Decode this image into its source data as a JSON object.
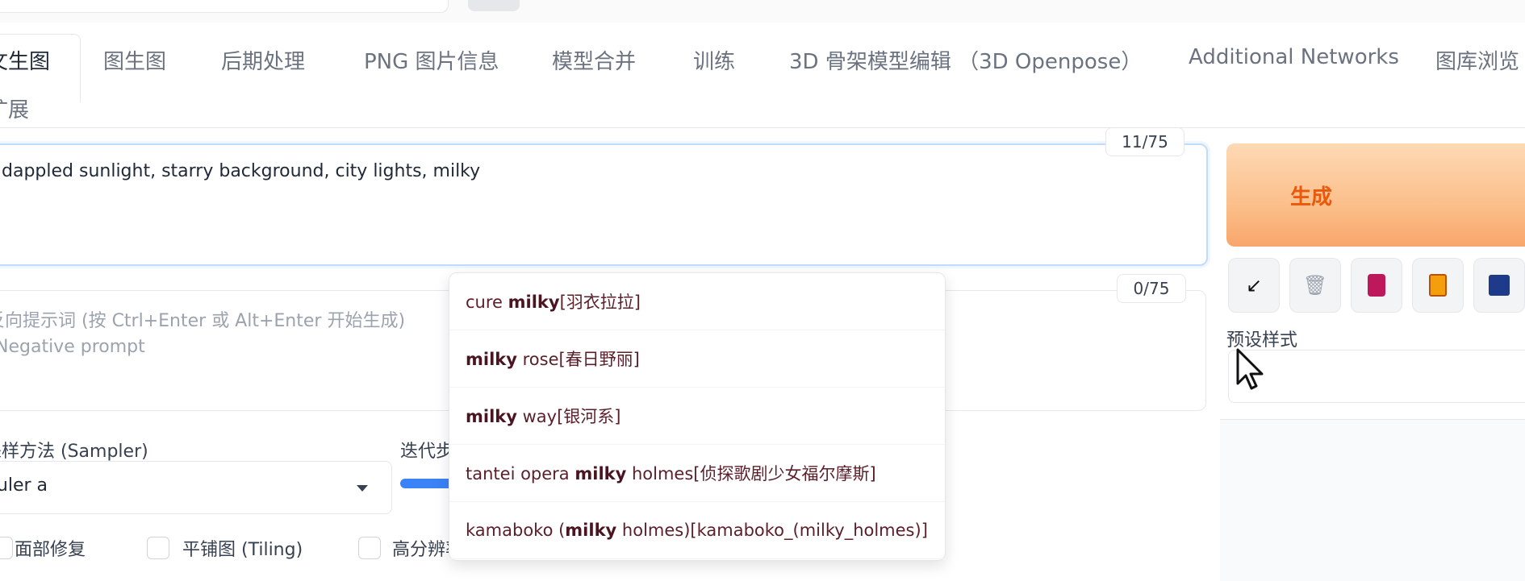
{
  "tabs": [
    {
      "label": "文生图",
      "active": true
    },
    {
      "label": "图生图"
    },
    {
      "label": "后期处理"
    },
    {
      "label": "PNG 图片信息"
    },
    {
      "label": "模型合并"
    },
    {
      "label": "训练"
    },
    {
      "label": "3D 骨架模型编辑 （3D Openpose）"
    },
    {
      "label": "Additional Networks"
    },
    {
      "label": "图库浏览"
    }
  ],
  "tabs_row2": {
    "label": "扩展"
  },
  "prompt": {
    "text": "dappled sunlight, starry background, city lights, milky",
    "counter": "11/75"
  },
  "negative_prompt": {
    "counter": "0/75",
    "placeholder_line1": "反向提示词 (按 Ctrl+Enter 或 Alt+Enter 开始生成)",
    "placeholder_line2": "Negative prompt"
  },
  "generate": {
    "label": "生成"
  },
  "tools": [
    {
      "icon": "arrow-in-icon",
      "glyph": "↙"
    },
    {
      "icon": "trash-icon",
      "glyph": "🗑"
    },
    {
      "icon": "card-icon",
      "glyph": "🎴"
    },
    {
      "icon": "clipboard-icon",
      "glyph": "📋"
    },
    {
      "icon": "save-icon",
      "glyph": "💾"
    }
  ],
  "styles": {
    "label": "预设样式",
    "value": ""
  },
  "sampler": {
    "label": "采样方法 (Sampler)",
    "value": "Euler a"
  },
  "steps": {
    "label": "迭代步数",
    "progress": 0.05
  },
  "checkboxes": [
    {
      "label": "面部修复",
      "checked": false
    },
    {
      "label": "平铺图 (Tiling)",
      "checked": false
    },
    {
      "label": "高分辨率修复",
      "checked": false
    }
  ],
  "autocomplete": [
    {
      "before": "cure ",
      "match": "milky",
      "after": "[羽衣拉拉]"
    },
    {
      "before": "",
      "match": "milky",
      "after": " rose[春日野丽]"
    },
    {
      "before": "",
      "match": "milky",
      "after": " way[银河系]"
    },
    {
      "before": "tantei opera ",
      "match": "milky",
      "after": " holmes[侦探歌剧少女福尔摩斯]"
    },
    {
      "before": "kamaboko (",
      "match": "milky",
      "after": " holmes)[kamaboko_(milky_holmes)]"
    }
  ],
  "colors": {
    "accent": "#ea580c",
    "focus": "#bfdbfe",
    "slider": "#3b82f6"
  }
}
